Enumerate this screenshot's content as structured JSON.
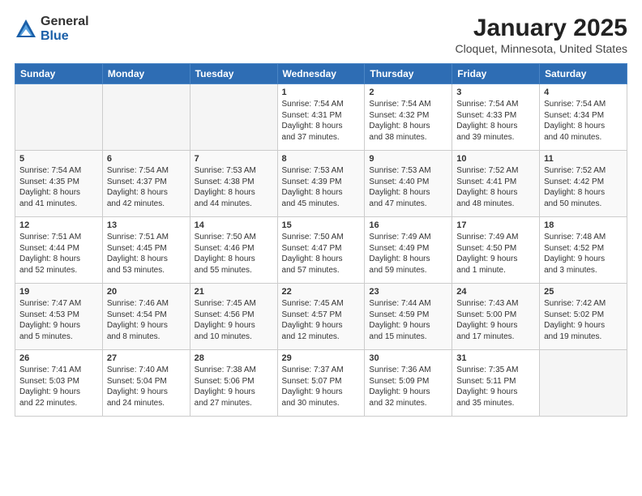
{
  "logo": {
    "general": "General",
    "blue": "Blue"
  },
  "header": {
    "month": "January 2025",
    "location": "Cloquet, Minnesota, United States"
  },
  "weekdays": [
    "Sunday",
    "Monday",
    "Tuesday",
    "Wednesday",
    "Thursday",
    "Friday",
    "Saturday"
  ],
  "weeks": [
    [
      {
        "day": "",
        "info": ""
      },
      {
        "day": "",
        "info": ""
      },
      {
        "day": "",
        "info": ""
      },
      {
        "day": "1",
        "info": "Sunrise: 7:54 AM\nSunset: 4:31 PM\nDaylight: 8 hours\nand 37 minutes."
      },
      {
        "day": "2",
        "info": "Sunrise: 7:54 AM\nSunset: 4:32 PM\nDaylight: 8 hours\nand 38 minutes."
      },
      {
        "day": "3",
        "info": "Sunrise: 7:54 AM\nSunset: 4:33 PM\nDaylight: 8 hours\nand 39 minutes."
      },
      {
        "day": "4",
        "info": "Sunrise: 7:54 AM\nSunset: 4:34 PM\nDaylight: 8 hours\nand 40 minutes."
      }
    ],
    [
      {
        "day": "5",
        "info": "Sunrise: 7:54 AM\nSunset: 4:35 PM\nDaylight: 8 hours\nand 41 minutes."
      },
      {
        "day": "6",
        "info": "Sunrise: 7:54 AM\nSunset: 4:37 PM\nDaylight: 8 hours\nand 42 minutes."
      },
      {
        "day": "7",
        "info": "Sunrise: 7:53 AM\nSunset: 4:38 PM\nDaylight: 8 hours\nand 44 minutes."
      },
      {
        "day": "8",
        "info": "Sunrise: 7:53 AM\nSunset: 4:39 PM\nDaylight: 8 hours\nand 45 minutes."
      },
      {
        "day": "9",
        "info": "Sunrise: 7:53 AM\nSunset: 4:40 PM\nDaylight: 8 hours\nand 47 minutes."
      },
      {
        "day": "10",
        "info": "Sunrise: 7:52 AM\nSunset: 4:41 PM\nDaylight: 8 hours\nand 48 minutes."
      },
      {
        "day": "11",
        "info": "Sunrise: 7:52 AM\nSunset: 4:42 PM\nDaylight: 8 hours\nand 50 minutes."
      }
    ],
    [
      {
        "day": "12",
        "info": "Sunrise: 7:51 AM\nSunset: 4:44 PM\nDaylight: 8 hours\nand 52 minutes."
      },
      {
        "day": "13",
        "info": "Sunrise: 7:51 AM\nSunset: 4:45 PM\nDaylight: 8 hours\nand 53 minutes."
      },
      {
        "day": "14",
        "info": "Sunrise: 7:50 AM\nSunset: 4:46 PM\nDaylight: 8 hours\nand 55 minutes."
      },
      {
        "day": "15",
        "info": "Sunrise: 7:50 AM\nSunset: 4:47 PM\nDaylight: 8 hours\nand 57 minutes."
      },
      {
        "day": "16",
        "info": "Sunrise: 7:49 AM\nSunset: 4:49 PM\nDaylight: 8 hours\nand 59 minutes."
      },
      {
        "day": "17",
        "info": "Sunrise: 7:49 AM\nSunset: 4:50 PM\nDaylight: 9 hours\nand 1 minute."
      },
      {
        "day": "18",
        "info": "Sunrise: 7:48 AM\nSunset: 4:52 PM\nDaylight: 9 hours\nand 3 minutes."
      }
    ],
    [
      {
        "day": "19",
        "info": "Sunrise: 7:47 AM\nSunset: 4:53 PM\nDaylight: 9 hours\nand 5 minutes."
      },
      {
        "day": "20",
        "info": "Sunrise: 7:46 AM\nSunset: 4:54 PM\nDaylight: 9 hours\nand 8 minutes."
      },
      {
        "day": "21",
        "info": "Sunrise: 7:45 AM\nSunset: 4:56 PM\nDaylight: 9 hours\nand 10 minutes."
      },
      {
        "day": "22",
        "info": "Sunrise: 7:45 AM\nSunset: 4:57 PM\nDaylight: 9 hours\nand 12 minutes."
      },
      {
        "day": "23",
        "info": "Sunrise: 7:44 AM\nSunset: 4:59 PM\nDaylight: 9 hours\nand 15 minutes."
      },
      {
        "day": "24",
        "info": "Sunrise: 7:43 AM\nSunset: 5:00 PM\nDaylight: 9 hours\nand 17 minutes."
      },
      {
        "day": "25",
        "info": "Sunrise: 7:42 AM\nSunset: 5:02 PM\nDaylight: 9 hours\nand 19 minutes."
      }
    ],
    [
      {
        "day": "26",
        "info": "Sunrise: 7:41 AM\nSunset: 5:03 PM\nDaylight: 9 hours\nand 22 minutes."
      },
      {
        "day": "27",
        "info": "Sunrise: 7:40 AM\nSunset: 5:04 PM\nDaylight: 9 hours\nand 24 minutes."
      },
      {
        "day": "28",
        "info": "Sunrise: 7:38 AM\nSunset: 5:06 PM\nDaylight: 9 hours\nand 27 minutes."
      },
      {
        "day": "29",
        "info": "Sunrise: 7:37 AM\nSunset: 5:07 PM\nDaylight: 9 hours\nand 30 minutes."
      },
      {
        "day": "30",
        "info": "Sunrise: 7:36 AM\nSunset: 5:09 PM\nDaylight: 9 hours\nand 32 minutes."
      },
      {
        "day": "31",
        "info": "Sunrise: 7:35 AM\nSunset: 5:11 PM\nDaylight: 9 hours\nand 35 minutes."
      },
      {
        "day": "",
        "info": ""
      }
    ]
  ]
}
